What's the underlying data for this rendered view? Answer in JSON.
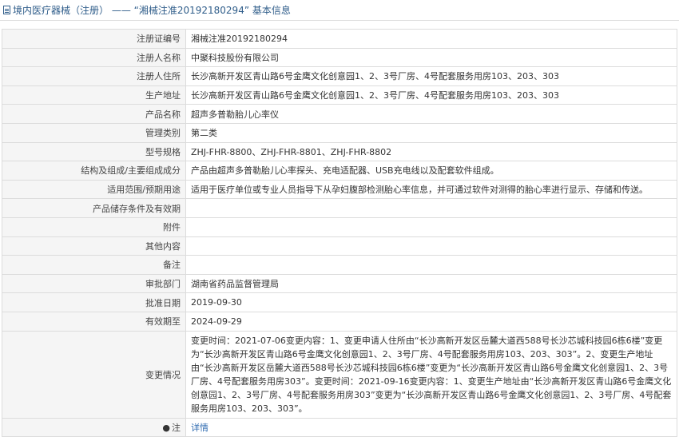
{
  "header": {
    "title": "境内医疗器械（注册） —— “湘械注准20192180294” 基本信息"
  },
  "rows": [
    {
      "label": "注册证编号",
      "value": "湘械注准20192180294"
    },
    {
      "label": "注册人名称",
      "value": "中聚科技股份有限公司"
    },
    {
      "label": "注册人住所",
      "value": "长沙高新开发区青山路6号金鹰文化创意园1、2、3号厂房、4号配套服务用房103、203、303"
    },
    {
      "label": "生产地址",
      "value": "长沙高新开发区青山路6号金鹰文化创意园1、2、3号厂房、4号配套服务用房103、203、303"
    },
    {
      "label": "产品名称",
      "value": "超声多普勒胎儿心率仪"
    },
    {
      "label": "管理类别",
      "value": "第二类"
    },
    {
      "label": "型号规格",
      "value": "ZHJ-FHR-8800、ZHJ-FHR-8801、ZHJ-FHR-8802"
    },
    {
      "label": "结构及组成/主要组成成分",
      "value": "产品由超声多普勒胎儿心率探头、充电适配器、USB充电线以及配套软件组成。"
    },
    {
      "label": "适用范围/预期用途",
      "value": "适用于医疗单位或专业人员指导下从孕妇腹部检测胎心率信息，并可通过软件对测得的胎心率进行显示、存储和传送。"
    },
    {
      "label": "产品储存条件及有效期",
      "value": ""
    },
    {
      "label": "附件",
      "value": ""
    },
    {
      "label": "其他内容",
      "value": ""
    },
    {
      "label": "备注",
      "value": ""
    },
    {
      "label": "审批部门",
      "value": "湖南省药品监督管理局"
    },
    {
      "label": "批准日期",
      "value": "2019-09-30"
    },
    {
      "label": "有效期至",
      "value": "2024-09-29"
    }
  ],
  "changes": {
    "label": "变更情况",
    "value": "变更时间：2021-07-06变更内容：1、变更申请人住所由“长沙高新开发区岳麓大道西588号长沙芯城科技园6栋6楼”变更为“长沙高新开发区青山路6号金鹰文化创意园1、2、3号厂房、4号配套服务用房103、203、303”。2、变更生产地址由“长沙高新开发区岳麓大道西588号长沙芯城科技园6栋6楼”变更为“长沙高新开发区青山路6号金鹰文化创意园1、2、3号厂房、4号配套服务用房303”。变更时间：2021-09-16变更内容：1、变更生产地址由“长沙高新开发区青山路6号金鹰文化创意园1、2、3号厂房、4号配套服务用房303”变更为“长沙高新开发区青山路6号金鹰文化创意园1、2、3号厂房、4号配套服务用房103、203、303”。"
  },
  "note": {
    "label": "注",
    "link_text": "详情"
  }
}
